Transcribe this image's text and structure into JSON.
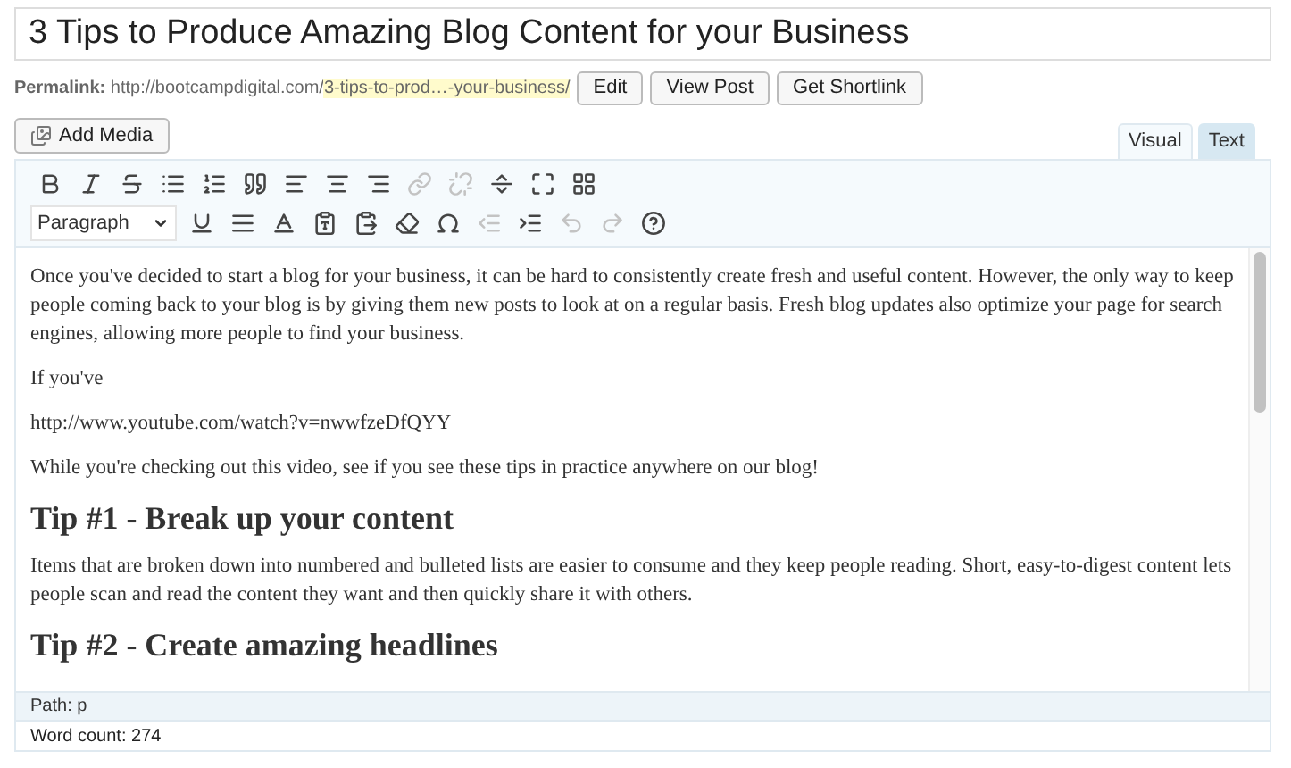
{
  "title": "3 Tips to Produce Amazing Blog Content for your Business",
  "permalink": {
    "label": "Permalink:",
    "base": "http://bootcampdigital.com/",
    "slug": "3-tips-to-prod…-your-business/",
    "buttons": [
      "Edit",
      "View Post",
      "Get Shortlink"
    ]
  },
  "add_media": "Add Media",
  "tabs": [
    {
      "label": "Visual",
      "selected": true
    },
    {
      "label": "Text",
      "selected": false
    }
  ],
  "toolbar_rows": [
    [
      {
        "kind": "bold",
        "disabled": false
      },
      {
        "kind": "italic",
        "disabled": false
      },
      {
        "kind": "strike",
        "disabled": false
      },
      {
        "kind": "bullets",
        "disabled": false
      },
      {
        "kind": "numbers",
        "disabled": false
      },
      {
        "kind": "quote",
        "disabled": false
      },
      {
        "kind": "align-left",
        "disabled": false
      },
      {
        "kind": "align-center",
        "disabled": false
      },
      {
        "kind": "align-right",
        "disabled": false
      },
      {
        "kind": "link",
        "disabled": true
      },
      {
        "kind": "unlink",
        "disabled": true
      },
      {
        "kind": "more",
        "disabled": false
      },
      {
        "kind": "fullscreen",
        "disabled": false
      },
      {
        "kind": "kitchen-sink",
        "disabled": false
      }
    ],
    [
      {
        "kind": "underline",
        "disabled": false
      },
      {
        "kind": "justify",
        "disabled": false
      },
      {
        "kind": "text-color",
        "disabled": false
      },
      {
        "kind": "paste-text",
        "disabled": false
      },
      {
        "kind": "paste-word",
        "disabled": false
      },
      {
        "kind": "eraser",
        "disabled": false
      },
      {
        "kind": "omega",
        "disabled": false
      },
      {
        "kind": "outdent",
        "disabled": true
      },
      {
        "kind": "indent",
        "disabled": false
      },
      {
        "kind": "undo",
        "disabled": true
      },
      {
        "kind": "redo",
        "disabled": true
      },
      {
        "kind": "help",
        "disabled": false
      }
    ]
  ],
  "format_select": "Paragraph",
  "content": [
    {
      "kind": "p",
      "text": "Once you've decided to start a blog for your business, it can be hard to consistently create fresh and useful content. However, the only way to keep people coming back to your blog is by giving them new posts to look at on a regular basis. Fresh blog updates also optimize your page for search engines, allowing more people to find your business."
    },
    {
      "kind": "p",
      "text": "If you've"
    },
    {
      "kind": "p",
      "text": "http://www.youtube.com/watch?v=nwwfzeDfQYY"
    },
    {
      "kind": "p",
      "text": "While you're checking out this video, see if you see these tips in practice anywhere on our blog!"
    },
    {
      "kind": "h",
      "text": "Tip #1 - Break up your content"
    },
    {
      "kind": "p",
      "text": "Items that are broken down into numbered and bulleted lists are easier to consume and they keep people reading. Short, easy-to-digest content lets people scan and read the content they want and then quickly share it with others."
    },
    {
      "kind": "h",
      "text": "Tip #2 - Create amazing headlines"
    }
  ],
  "path": "Path: p",
  "word_count": "Word count: 274"
}
